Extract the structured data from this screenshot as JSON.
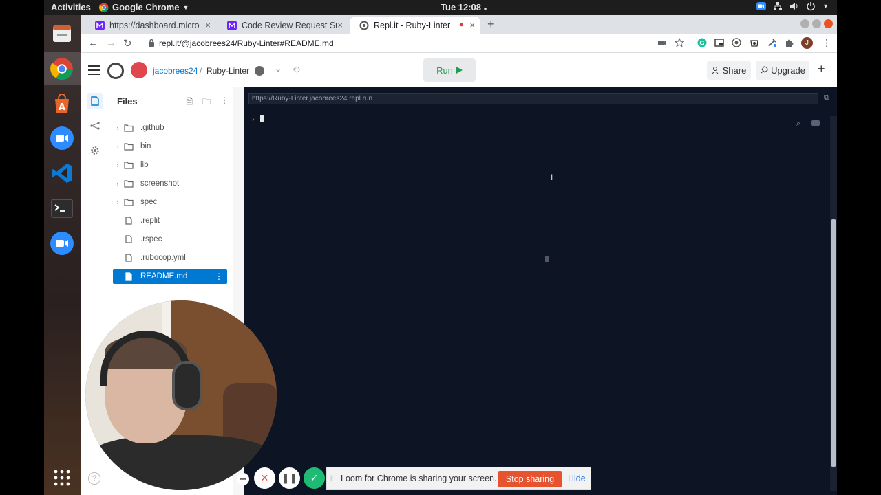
{
  "topbar": {
    "activities": "Activities",
    "app": "Google Chrome",
    "clock": "Tue 12:08"
  },
  "tabs": [
    {
      "label": "https://dashboard.micro",
      "close": "×"
    },
    {
      "label": "Code Review Request Sub",
      "close": "×"
    },
    {
      "label": "Repl.it - Ruby-Linter",
      "close": "×"
    }
  ],
  "newtab": "+",
  "omnibox": {
    "url": "repl.it/@jacobrees24/Ruby-Linter#README.md",
    "profile_initial": "J"
  },
  "repl": {
    "owner": "jacobrees24",
    "separator": "/",
    "name": "Ruby-Linter",
    "run_label": "Run",
    "share_label": "Share",
    "upgrade_label": "Upgrade",
    "add_label": "+"
  },
  "files": {
    "title": "Files",
    "items": [
      {
        "name": ".github",
        "type": "folder"
      },
      {
        "name": "bin",
        "type": "folder"
      },
      {
        "name": "lib",
        "type": "folder"
      },
      {
        "name": "screenshot",
        "type": "folder"
      },
      {
        "name": "spec",
        "type": "folder"
      },
      {
        "name": ".replit",
        "type": "file"
      },
      {
        "name": ".rspec",
        "type": "file"
      },
      {
        "name": ".rubocop.yml",
        "type": "file"
      },
      {
        "name": "README.md",
        "type": "file",
        "selected": true
      }
    ]
  },
  "console": {
    "url": "https://Ruby-Linter.jacobrees24.repl.run",
    "prompt": "›"
  },
  "loom": {
    "message": "Loom for Chrome is sharing your screen.",
    "stop_label": "Stop sharing",
    "hide_label": "Hide",
    "help_label": "?"
  },
  "colors": {
    "accent": "#0079d3",
    "run_green": "#1f9d55",
    "console_bg": "#0d1424",
    "loom_stop": "#e8532f"
  }
}
